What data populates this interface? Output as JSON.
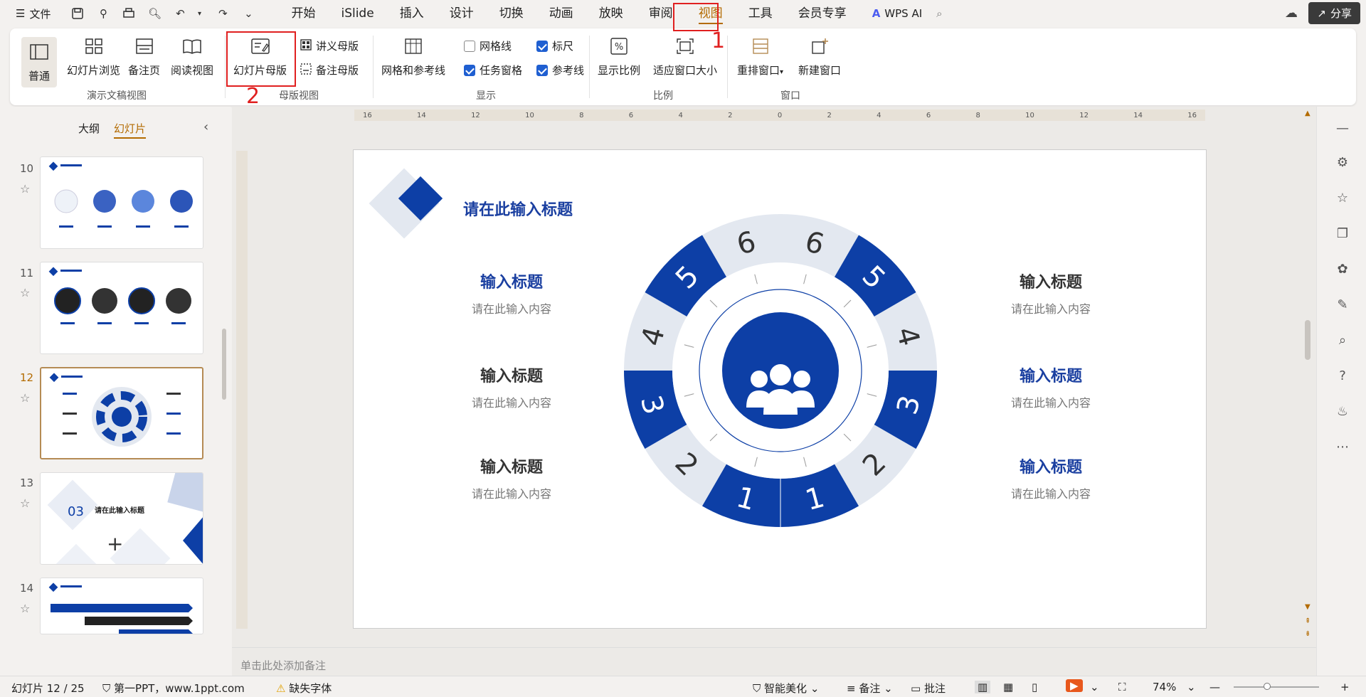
{
  "topbar": {
    "file_label": "文件",
    "menu": [
      "开始",
      "iSlide",
      "插入",
      "设计",
      "切换",
      "动画",
      "放映",
      "审阅",
      "视图",
      "工具",
      "会员专享"
    ],
    "active_menu_index": 8,
    "wps_ai": "WPS AI",
    "share_label": "分享"
  },
  "ribbon": {
    "view_group": {
      "label": "演示文稿视图",
      "normal": "普通",
      "slide_sorter": "幻灯片浏览",
      "notes_page": "备注页",
      "reading_view": "阅读视图"
    },
    "master_group": {
      "label": "母版视图",
      "slide_master": "幻灯片母版",
      "handout_master": "讲义母版",
      "notes_master": "备注母版"
    },
    "show_group": {
      "label": "显示",
      "grid_guides": "网格和参考线",
      "gridlines": "网格线",
      "gridlines_checked": false,
      "task_pane": "任务窗格",
      "task_pane_checked": true,
      "ruler": "标尺",
      "ruler_checked": true,
      "guides": "参考线",
      "guides_checked": true
    },
    "zoom_group": {
      "label": "比例",
      "zoom": "显示比例",
      "fit": "适应窗口大小"
    },
    "window_group": {
      "label": "窗口",
      "arrange": "重排窗口",
      "new_window": "新建窗口"
    }
  },
  "annotations": {
    "mark1": "1",
    "mark2": "2",
    "color": "#e02020"
  },
  "left_panel": {
    "tab_outline": "大纲",
    "tab_slides": "幻灯片",
    "thumbnails": [
      {
        "num": "10"
      },
      {
        "num": "11"
      },
      {
        "num": "12",
        "selected": true
      },
      {
        "num": "13",
        "title": "请在此输入标题",
        "badge": "03"
      },
      {
        "num": "14"
      }
    ]
  },
  "slide": {
    "title": "请在此输入标题",
    "left_items": [
      {
        "heading": "输入标题",
        "content": "请在此输入内容",
        "color": "#1a3fa0"
      },
      {
        "heading": "输入标题",
        "content": "请在此输入内容",
        "color": "#333333"
      },
      {
        "heading": "输入标题",
        "content": "请在此输入内容",
        "color": "#333333"
      }
    ],
    "right_items": [
      {
        "heading": "输入标题",
        "content": "请在此输入内容",
        "color": "#333333"
      },
      {
        "heading": "输入标题",
        "content": "请在此输入内容",
        "color": "#1a3fa0"
      },
      {
        "heading": "输入标题",
        "content": "请在此输入内容",
        "color": "#1a3fa0"
      }
    ],
    "ring_numbers": [
      "1",
      "1",
      "2",
      "2",
      "3",
      "3",
      "4",
      "4",
      "5",
      "5",
      "6",
      "6"
    ],
    "accent": "#0d3fa6",
    "light": "#e3e8f0"
  },
  "notes_placeholder": "单击此处添加备注",
  "status": {
    "slide_info": "幻灯片 12 / 25",
    "theme": "第一PPT，www.1ppt.com",
    "missing_font": "缺失字体",
    "smart_beautify": "智能美化",
    "notes": "备注",
    "comments": "批注",
    "zoom": "74%"
  }
}
